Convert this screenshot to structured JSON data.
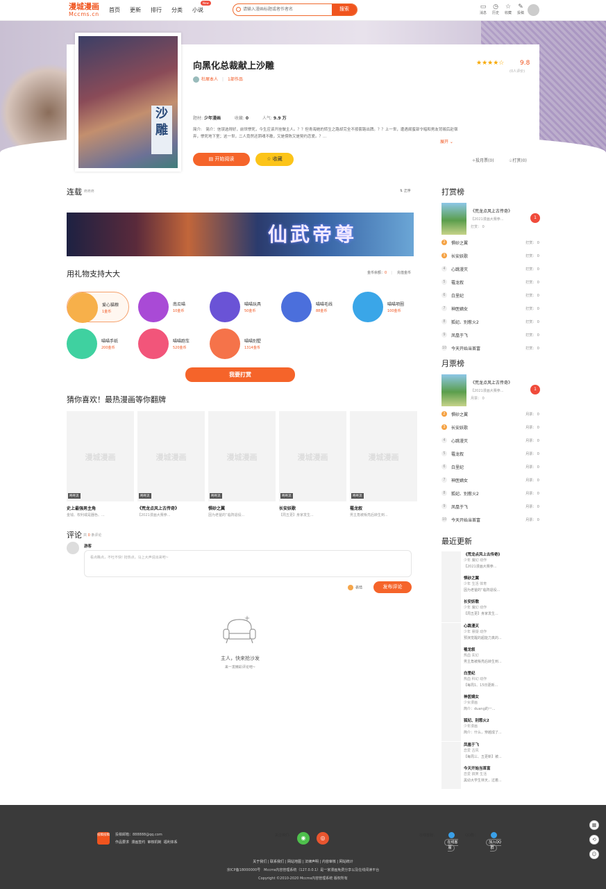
{
  "header": {
    "logo": "漫城漫画",
    "logo_sub": "Mccms.cn",
    "nav": [
      "首页",
      "更新",
      "排行",
      "分类",
      "小说"
    ],
    "new_badge": "New",
    "search_placeholder": "请输入漫画标题或者作者名",
    "search_btn": "搜索",
    "icons": [
      {
        "label": "消息",
        "icon": "message-icon",
        "glyph": "▭"
      },
      {
        "label": "历史",
        "icon": "history-icon",
        "glyph": "◷"
      },
      {
        "label": "收藏",
        "icon": "star-icon",
        "glyph": "☆"
      },
      {
        "label": "投稿",
        "icon": "upload-icon",
        "glyph": "✎"
      }
    ]
  },
  "book": {
    "title": "向黑化总裁献上沙雕",
    "author": "杜犀本人",
    "works": "1部作品",
    "meta": [
      "题材:",
      "少年漫画",
      "收藏:",
      "0",
      "人气:",
      "9.9 万"
    ],
    "desc": "简介:　简介：信误选得好，前世惨死，今生应该开挂做主人。？？但青海她的转生之路却完全不按套路出牌。？？上一世，遭遇闺蜜部令暗和男友背叛后赴宿弃，惨死地下室；这一世，二人竟然还阴魂不散，又是傍陈又是契约恋爱。？...",
    "expand": "展开 ⌄",
    "stars": "★★★★☆",
    "score": "9.8",
    "rating_count": "(0人评价)",
    "read_btn": "开始阅读",
    "fav_btn": "收藏",
    "month_ticket": "投月票(0)",
    "tip": "打赏(0)",
    "cover_text": "沙雕"
  },
  "serial": {
    "title": "连载",
    "sub": "咚咚咚",
    "sort": "⇅ 正序",
    "banner_text": "仙武帝尊"
  },
  "gifts": {
    "title": "用礼物支持大大",
    "balance_label": "金币余额：",
    "balance": "0",
    "charge": "充值金币",
    "items": [
      {
        "name": "爱心猫粮",
        "price": "1金币",
        "color": "#f7b04a"
      },
      {
        "name": "南瓜喵",
        "price": "10金币",
        "color": "#a94ad6"
      },
      {
        "name": "喵喵玩具",
        "price": "50金币",
        "color": "#6a53d6"
      },
      {
        "name": "喵喵毛线",
        "price": "88金币",
        "color": "#4b6fdc"
      },
      {
        "name": "喵喵项圈",
        "price": "100金币",
        "color": "#3aa6e8"
      },
      {
        "name": "喵喵手纸",
        "price": "200金币",
        "color": "#3fd1a0"
      },
      {
        "name": "喵喵跑车",
        "price": "520金币",
        "color": "#f2557a"
      },
      {
        "name": "喵喵别墅",
        "price": "1314金币",
        "color": "#f5734a"
      }
    ],
    "submit": "我要打赏"
  },
  "guess": {
    "title": "猜你喜欢！最热漫画等你翻牌",
    "watermark": "漫城漫画",
    "items": [
      {
        "tag": "咚咚流",
        "name": "史上最强男主角",
        "desc": "金钱、权利或是器色、..."
      },
      {
        "tag": "咚咚流",
        "name": "《荒龙点风上古传奇》",
        "desc": "【2021漫画大赛参..."
      },
      {
        "tag": "咚咚流",
        "name": "惧砂之翼",
        "desc": "因为老爸的“临阵退役..."
      },
      {
        "tag": "咚咚流",
        "name": "长安妖歌",
        "desc": "【周五更】身家发生..."
      },
      {
        "tag": "咚咚流",
        "name": "罹龙叙",
        "desc": "男主角被叛亮后转生到..."
      }
    ]
  },
  "comments": {
    "title": "评论",
    "count_prefix": "共",
    "count": "0",
    "count_suffix": "条评论",
    "guest": "游客",
    "placeholder": "看点瞧点，不吐不快! 抢热点，马上大声说出来吧~",
    "emoji": "表情",
    "post": "发布评论",
    "empty_title": "主人，快来抢沙发",
    "empty_sub": "来一发精彩评论吧~"
  },
  "tip_rank": {
    "title": "打赏榜",
    "top": {
      "name": "《荒龙点风上古传奇》",
      "desc": "【2021漫画大赛参...",
      "val": "打赏： 0",
      "badge": "1"
    },
    "items": [
      {
        "n": "2",
        "name": "惧砂之翼",
        "val": "打赏： 0"
      },
      {
        "n": "3",
        "name": "长安妖歌",
        "val": "打赏： 0"
      },
      {
        "n": "4",
        "name": "心跳漫灭",
        "val": "打赏： 0"
      },
      {
        "n": "5",
        "name": "罹龙叙",
        "val": "打赏： 0"
      },
      {
        "n": "6",
        "name": "白里纪",
        "val": "打赏： 0"
      },
      {
        "n": "7",
        "name": "神医嫡女",
        "val": "打赏： 0"
      },
      {
        "n": "8",
        "name": "狐妃、别惹火2",
        "val": "打赏： 0"
      },
      {
        "n": "9",
        "name": "凤凰于飞",
        "val": "打赏： 0"
      },
      {
        "n": "10",
        "name": "今天开始当首富",
        "val": "打赏： 0"
      }
    ]
  },
  "month_rank": {
    "title": "月票榜",
    "top": {
      "name": "《荒龙点风上古传奇》",
      "desc": "【2021漫画大赛参...",
      "val": "月票： 0",
      "badge": "1"
    },
    "items": [
      {
        "n": "2",
        "name": "惧砂之翼",
        "val": "月票： 0"
      },
      {
        "n": "3",
        "name": "长安妖歌",
        "val": "月票： 0"
      },
      {
        "n": "4",
        "name": "心跳漫灭",
        "val": "月票： 0"
      },
      {
        "n": "5",
        "name": "罹龙叙",
        "val": "月票： 0"
      },
      {
        "n": "6",
        "name": "白里纪",
        "val": "月票： 0"
      },
      {
        "n": "7",
        "name": "神医嫡女",
        "val": "月票： 0"
      },
      {
        "n": "8",
        "name": "狐妃、别惹火2",
        "val": "月票： 0"
      },
      {
        "n": "9",
        "name": "凤凰于飞",
        "val": "月票： 0"
      },
      {
        "n": "10",
        "name": "今天开始当首富",
        "val": "月票： 0"
      }
    ]
  },
  "recent": {
    "title": "最近更新",
    "items": [
      {
        "name": "《荒龙点风上古传奇》",
        "genre": "少年 魔幻 动作",
        "desc": "【2021漫画大赛参..."
      },
      {
        "name": "惧砂之翼",
        "genre": "少年 生活 体育",
        "desc": "因为老爸的“临阵退役..."
      },
      {
        "name": "长安妖歌",
        "genre": "少年 魔幻 动作",
        "desc": "【周五更】身家发生..."
      },
      {
        "name": "心跳漫灭",
        "genre": "少年 悬疑 动作",
        "desc": "预演觉醒的超能力真的..."
      },
      {
        "name": "罹龙叙",
        "genre": "热血 玄幻",
        "desc": "男主角被叛亮后转生到..."
      },
      {
        "name": "白里纪",
        "genre": "热血 科幻 动作",
        "desc": "【每周1、15日更新..."
      },
      {
        "name": "神医嫡女",
        "genre": "少女漫画",
        "desc": "简介：duang的一..."
      },
      {
        "name": "狐妃、别惹火2",
        "genre": "少年漫画",
        "desc": "简介：什么，穿越成了..."
      },
      {
        "name": "凤凰于飞",
        "genre": "恋爱 古风",
        "desc": "【每周三、五更新】被..."
      },
      {
        "name": "今天开始当首富",
        "genre": "恋爱 搞笑 生活",
        "desc": "黑幼大学生林天，过着..."
      }
    ]
  },
  "footer": {
    "logo": "投稿投稿",
    "mail": "投稿邮箱：888888@qq.com",
    "links1": [
      "作品要求",
      "漫画签约",
      "审核机制",
      "福利体系"
    ],
    "follow": "关注我们：",
    "service": "在线客服：",
    "service_btn": "在线客服",
    "qq": "QQ群：",
    "qq_btn": "加入QQ群",
    "links2": [
      "关于我们",
      "联系我们",
      "网站地图",
      "法律声明",
      "内容审核",
      "网站统计"
    ],
    "icp": "京ICP备18000000号　Mccms内容管理系统（127.0.0.1）是一家漫画免费分享以及在线阅读平台",
    "copy": "Copyright ©2010-2020 Mccms内容管理系统 版权所有"
  },
  "side": [
    "▦",
    "⟲",
    "☺"
  ]
}
